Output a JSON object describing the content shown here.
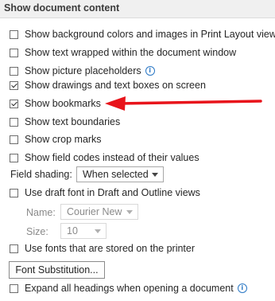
{
  "section_title": "Show document content",
  "options": [
    {
      "label": "Show background colors and images in Print Layout view",
      "checked": false
    },
    {
      "label": "Show text wrapped within the document window",
      "checked": false
    },
    {
      "label": "Show picture placeholders",
      "checked": false
    },
    {
      "label": "Show drawings and text boxes on screen",
      "checked": true
    },
    {
      "label": "Show bookmarks",
      "checked": true
    },
    {
      "label": "Show text boundaries",
      "checked": false
    },
    {
      "label": "Show crop marks",
      "checked": false
    },
    {
      "label": "Show field codes instead of their values",
      "checked": false
    }
  ],
  "field_shading": {
    "label": "Field shading:",
    "value": "When selected"
  },
  "draft_font": {
    "label": "Use draft font in Draft and Outline views",
    "checked": false
  },
  "name": {
    "label": "Name:",
    "value": "Courier New"
  },
  "size": {
    "label": "Size:",
    "value": "10"
  },
  "printer_fonts": {
    "label": "Use fonts that are stored on the printer",
    "checked": false
  },
  "font_substitution_button": "Font Substitution...",
  "expand_headings": {
    "label": "Expand all headings when opening a document",
    "checked": false
  },
  "colors": {
    "arrow": "#e8141b",
    "info": "#2b78c5"
  },
  "icons": [
    "info-icon",
    "red-arrow"
  ]
}
